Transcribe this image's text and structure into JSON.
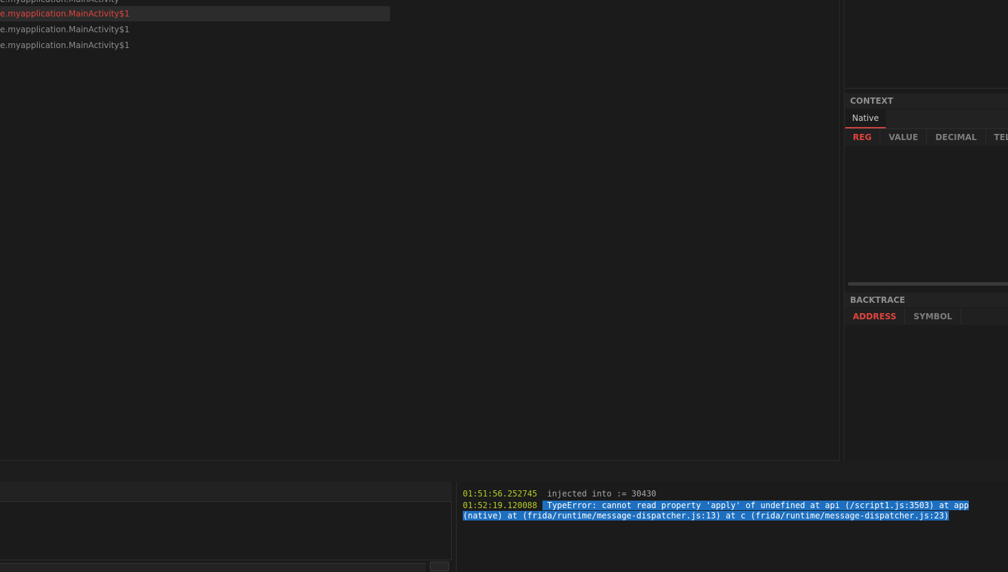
{
  "class_list": {
    "rows": [
      {
        "label": "e.myapplication.MainActivity",
        "selected": false
      },
      {
        "label": "e.myapplication.MainActivity$1",
        "selected": true
      },
      {
        "label": "e.myapplication.MainActivity$1",
        "selected": false
      },
      {
        "label": "e.myapplication.MainActivity$1",
        "selected": false
      }
    ]
  },
  "context": {
    "title": "CONTEXT",
    "tab_label": "Native",
    "columns": [
      "REG",
      "VALUE",
      "DECIMAL",
      "TELES"
    ]
  },
  "backtrace": {
    "title": "BACKTRACE",
    "columns": [
      "ADDRESS",
      "SYMBOL"
    ]
  },
  "console": {
    "lines": [
      {
        "timestamp": "01:51:56.252745",
        "message": "injected into := 30430",
        "error": false
      },
      {
        "timestamp": "01:52:19.120088",
        "message": "TypeError: cannot read property 'apply' of undefined at api (/script1.js:3503) at app",
        "error": true
      },
      {
        "timestamp": "",
        "message": "(native) at (frida/runtime/message-dispatcher.js:13) at c (frida/runtime/message-dispatcher.js:23)",
        "error": true
      }
    ]
  },
  "colors": {
    "accent": "#e0443e",
    "timestamp": "#b7cb28",
    "selection": "#1e6fbf"
  }
}
